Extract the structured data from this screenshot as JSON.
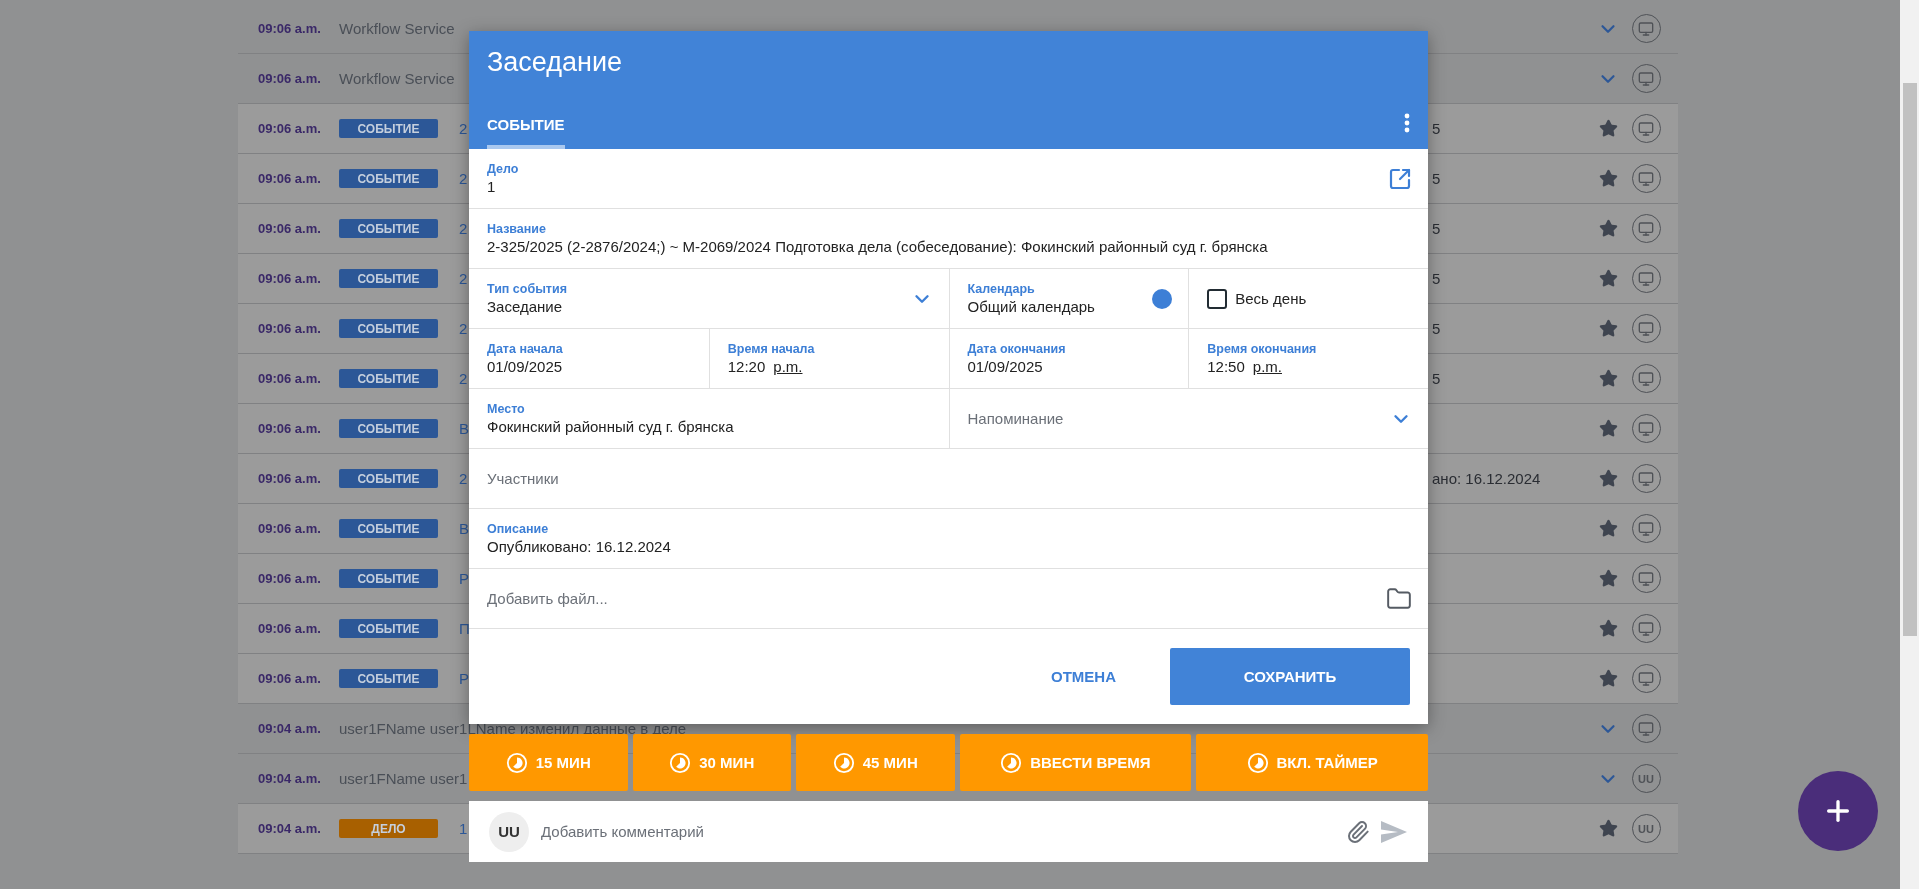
{
  "feed": {
    "rows": [
      {
        "kind": "message",
        "time": "09:06 a.m.",
        "text": "Workflow Service",
        "action": {
          "kind": "expand"
        },
        "avatar": {
          "kind": "monitor"
        }
      },
      {
        "kind": "message",
        "time": "09:06 a.m.",
        "text": "Workflow Service",
        "action": {
          "kind": "expand"
        },
        "avatar": {
          "kind": "monitor"
        }
      },
      {
        "kind": "entity",
        "time": "09:06 a.m.",
        "badge": {
          "label": "СОБЫТИЕ",
          "color": "#2c5797"
        },
        "text": "2",
        "note": "5",
        "action": {
          "kind": "star"
        },
        "avatar": {
          "kind": "monitor"
        }
      },
      {
        "kind": "entity",
        "time": "09:06 a.m.",
        "badge": {
          "label": "СОБЫТИЕ",
          "color": "#2c5797"
        },
        "text": "2",
        "note": "5",
        "action": {
          "kind": "star"
        },
        "avatar": {
          "kind": "monitor"
        }
      },
      {
        "kind": "entity",
        "time": "09:06 a.m.",
        "badge": {
          "label": "СОБЫТИЕ",
          "color": "#2c5797"
        },
        "text": "2",
        "note": "5",
        "action": {
          "kind": "star"
        },
        "avatar": {
          "kind": "monitor"
        }
      },
      {
        "kind": "entity",
        "time": "09:06 a.m.",
        "badge": {
          "label": "СОБЫТИЕ",
          "color": "#2c5797"
        },
        "text": "2",
        "note": "5",
        "action": {
          "kind": "star"
        },
        "avatar": {
          "kind": "monitor"
        }
      },
      {
        "kind": "entity",
        "time": "09:06 a.m.",
        "badge": {
          "label": "СОБЫТИЕ",
          "color": "#2c5797"
        },
        "text": "2",
        "note": "5",
        "action": {
          "kind": "star"
        },
        "avatar": {
          "kind": "monitor"
        }
      },
      {
        "kind": "entity",
        "time": "09:06 a.m.",
        "badge": {
          "label": "СОБЫТИЕ",
          "color": "#2c5797"
        },
        "text": "2",
        "note": "5",
        "action": {
          "kind": "star"
        },
        "avatar": {
          "kind": "monitor"
        }
      },
      {
        "kind": "entity",
        "time": "09:06 a.m.",
        "badge": {
          "label": "СОБЫТИЕ",
          "color": "#2c5797"
        },
        "text": "В",
        "action": {
          "kind": "star"
        },
        "avatar": {
          "kind": "monitor"
        }
      },
      {
        "kind": "entity",
        "time": "09:06 a.m.",
        "badge": {
          "label": "СОБЫТИЕ",
          "color": "#2c5797"
        },
        "text": "2",
        "note": "ано: 16.12.2024",
        "action": {
          "kind": "star"
        },
        "avatar": {
          "kind": "monitor"
        }
      },
      {
        "kind": "entity",
        "time": "09:06 a.m.",
        "badge": {
          "label": "СОБЫТИЕ",
          "color": "#2c5797"
        },
        "text": "В",
        "action": {
          "kind": "star"
        },
        "avatar": {
          "kind": "monitor"
        }
      },
      {
        "kind": "entity",
        "time": "09:06 a.m.",
        "badge": {
          "label": "СОБЫТИЕ",
          "color": "#2c5797"
        },
        "text": "Р",
        "action": {
          "kind": "star"
        },
        "avatar": {
          "kind": "monitor"
        }
      },
      {
        "kind": "entity",
        "time": "09:06 a.m.",
        "badge": {
          "label": "СОБЫТИЕ",
          "color": "#2c5797"
        },
        "text": "П",
        "action": {
          "kind": "star"
        },
        "avatar": {
          "kind": "monitor"
        }
      },
      {
        "kind": "entity",
        "time": "09:06 a.m.",
        "badge": {
          "label": "СОБЫТИЕ",
          "color": "#2c5797"
        },
        "text": "Р",
        "action": {
          "kind": "star"
        },
        "avatar": {
          "kind": "monitor"
        }
      },
      {
        "kind": "message",
        "time": "09:04 a.m.",
        "text": "user1FName user1LName изменил данные в деле",
        "action": {
          "kind": "expand"
        },
        "avatar": {
          "kind": "monitor"
        }
      },
      {
        "kind": "message",
        "time": "09:04 a.m.",
        "text": "user1FName user1",
        "action": {
          "kind": "expand"
        },
        "avatar": {
          "kind": "initials",
          "text": "UU"
        }
      },
      {
        "kind": "entity",
        "time": "09:04 a.m.",
        "badge": {
          "label": "ДЕЛО",
          "color": "#a86000"
        },
        "text": "1",
        "action": {
          "kind": "star"
        },
        "avatar": {
          "kind": "initials",
          "text": "UU"
        }
      }
    ]
  },
  "dialog": {
    "title": "Заседание",
    "tabs": [
      {
        "label": "СОБЫТИЕ",
        "selected": true
      }
    ],
    "form": {
      "case": {
        "kind": "link",
        "label": "Дело",
        "value": "1"
      },
      "name": {
        "kind": "text",
        "label": "Название",
        "value": "2-325/2025 (2-2876/2024;) ~ М-2069/2024 Подготовка дела (собеседование): Фокинский районный суд г. брянска"
      },
      "event_type": {
        "kind": "select",
        "label": "Тип события",
        "value": "Заседание"
      },
      "calendar": {
        "kind": "calendar",
        "label": "Календарь",
        "value": "Общий календарь",
        "color": "#3d7fd6"
      },
      "all_day": {
        "kind": "checkbox",
        "label": "Весь день",
        "checked": false
      },
      "start_date": {
        "kind": "text",
        "label": "Дата начала",
        "value": "01/09/2025"
      },
      "start_time": {
        "kind": "time",
        "label": "Время начала",
        "value": "12:20",
        "period": "p.m."
      },
      "end_date": {
        "kind": "text",
        "label": "Дата окончания",
        "value": "01/09/2025"
      },
      "end_time": {
        "kind": "time",
        "label": "Время окончания",
        "value": "12:50",
        "period": "p.m."
      },
      "place": {
        "kind": "text",
        "label": "Место",
        "value": "Фокинский районный суд г. брянска"
      },
      "reminder": {
        "kind": "select",
        "placeholder": "Напоминание"
      },
      "participants": {
        "kind": "placeholder",
        "placeholder": "Участники"
      },
      "description": {
        "kind": "text",
        "label": "Описание",
        "value": "Опубликовано: 16.12.2024"
      },
      "attachment": {
        "kind": "file",
        "placeholder": "Добавить файл..."
      }
    },
    "actions": [
      {
        "kind": "text",
        "label": "ОТМЕНА"
      },
      {
        "kind": "primary",
        "label": "СОХРАНИТЬ"
      }
    ]
  },
  "quick_times": [
    {
      "label": "15 МИН"
    },
    {
      "label": "30 МИН"
    },
    {
      "label": "45 МИН"
    },
    {
      "label": "ВВЕСТИ ВРЕМЯ"
    },
    {
      "label": "ВКЛ. ТАЙМЕР"
    }
  ],
  "comment": {
    "avatar": "UU",
    "placeholder": "Добавить комментарий"
  }
}
